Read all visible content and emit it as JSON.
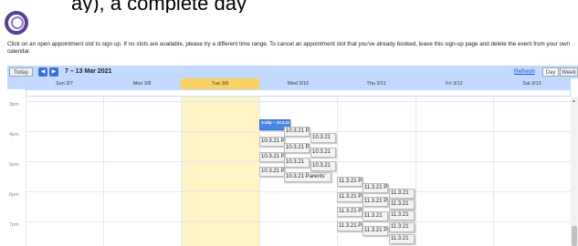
{
  "header_text": "ay), a complete day",
  "instructions": "Click on an open appointment slot to sign up. If no slots are available, please try a different time range. To cancel an appointment slot that you've already booked, leave this sign-up page and delete the event from your own calendar.",
  "toolbar": {
    "today_label": "Today",
    "prev_icon": "chevron-left-icon",
    "next_icon": "chevron-right-icon",
    "date_range": "7 – 13 Mar 2021",
    "refresh_label": "Refresh",
    "day_label": "Day",
    "week_label": "Week"
  },
  "days": [
    "Sun 3/7",
    "Mon 3/8",
    "Tue 3/9",
    "Wed 3/10",
    "Thu 3/11",
    "Fri 3/12",
    "Sat 3/13"
  ],
  "hours": [
    "3pm",
    "4pm",
    "5pm",
    "6pm",
    "7pm"
  ],
  "booked_slot": "3:40p – 10.3.21 Pa",
  "slots_wed": [
    "10.3.21 P",
    "10.3.21",
    "10.3.21 P",
    "10.3.21 P",
    "10.3.21",
    "10.3.21 P",
    "10.3.21",
    "10.3.21 P",
    "10.3.21",
    "10.3.21 Parents'"
  ],
  "slots_thu": [
    "11.3.21 P",
    "11.3.21 P",
    "11.3.21",
    "11.3.21 P",
    "11.3.21",
    "11.3.21 P",
    "11.3.21",
    "11.3.21 P",
    "11.3.21",
    "11.3.21 P",
    "11.3.21",
    "11.3.21 P",
    "11.3.21"
  ],
  "colors": {
    "toolbar_bg": "#c3d9ff",
    "today_column": "#fff4c6",
    "today_header": "#fad163",
    "booked_slot": "#4a86e8",
    "nav_button": "#3d6ed8"
  }
}
